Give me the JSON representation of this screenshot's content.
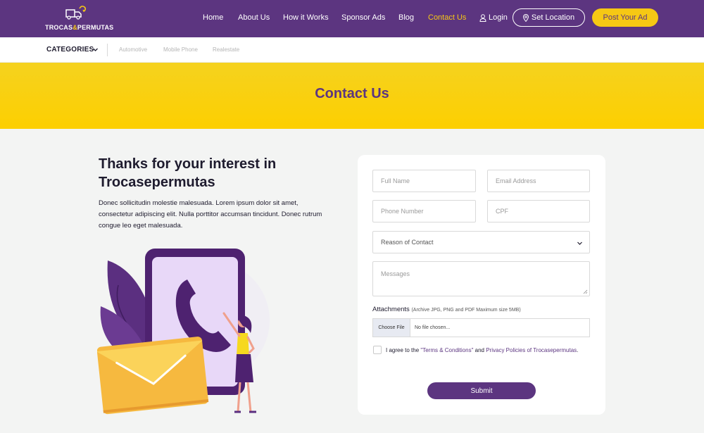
{
  "brand": {
    "name_left": "TROCAS",
    "name_amp": "&",
    "name_right": "PERMUTAS"
  },
  "nav": {
    "home": "Home",
    "about": "About Us",
    "how": "How it Works",
    "sponsor": "Sponsor Ads",
    "blog": "Blog",
    "contact": "Contact Us",
    "login": "Login",
    "set_location": "Set Location",
    "post_ad": "Post Your Ad"
  },
  "categories": {
    "title": "CATEGORIES",
    "items": [
      "Automotive",
      "Mobile Phone",
      "Realestate"
    ]
  },
  "banner": {
    "title": "Contact Us"
  },
  "intro": {
    "title": "Thanks for your interest in Trocasepermutas",
    "body": "Donec sollicitudin molestie malesuada. Lorem ipsum dolor sit amet, consectetur adipiscing elit. Nulla porttitor accumsan tincidunt. Donec rutrum congue leo eget malesuada."
  },
  "form": {
    "full_name": "Full Name",
    "email": "Email Address",
    "phone": "Phone Number",
    "cpf": "CPF",
    "reason": "Reason of Contact",
    "messages": "Messages",
    "attachments_label": "Attachments",
    "attachments_note": "(Archive JPG, PNG and PDF Maximum size 5MB)",
    "choose_file": "Choose File",
    "no_file": "No file chosen...",
    "agree_prefix": "I agree to the ",
    "terms": "\"Terms & Conditions\"",
    "agree_and": " and ",
    "privacy": "Privacy Policies of Trocasepermutas",
    "agree_suffix": ".",
    "submit": "Submit"
  },
  "colors": {
    "primary": "#5c3580",
    "accent": "#f6c814",
    "banner": "#fdcf00"
  }
}
